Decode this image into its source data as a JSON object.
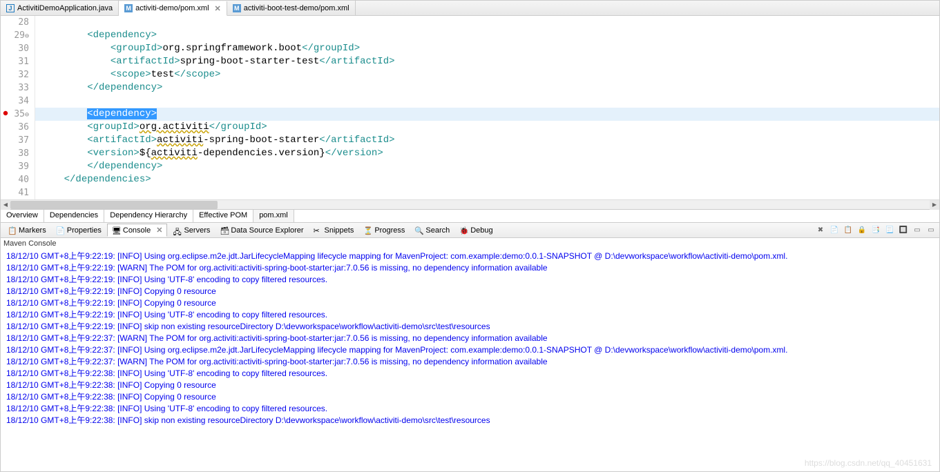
{
  "tabs": [
    {
      "label": "ActivitiDemoApplication.java",
      "icon": "J",
      "active": false
    },
    {
      "label": "activiti-demo/pom.xml",
      "icon": "M",
      "active": true
    },
    {
      "label": "activiti-boot-test-demo/pom.xml",
      "icon": "M",
      "active": false
    }
  ],
  "editor": {
    "lines": [
      {
        "n": "28",
        "html": ""
      },
      {
        "n": "29",
        "fold": "⊖",
        "html": "        <span class='tag'>&lt;dependency&gt;</span>"
      },
      {
        "n": "30",
        "html": "            <span class='tag'>&lt;groupId&gt;</span><span class='txt'>org.springframework.boot</span><span class='tag'>&lt;/groupId&gt;</span>"
      },
      {
        "n": "31",
        "html": "            <span class='tag'>&lt;artifactId&gt;</span><span class='txt'>spring-boot-starter-test</span><span class='tag'>&lt;/artifactId&gt;</span>"
      },
      {
        "n": "32",
        "html": "            <span class='tag'>&lt;scope&gt;</span><span class='txt'>test</span><span class='tag'>&lt;/scope&gt;</span>"
      },
      {
        "n": "33",
        "html": "        <span class='tag'>&lt;/dependency&gt;</span>"
      },
      {
        "n": "34",
        "html": ""
      },
      {
        "n": "35",
        "err": true,
        "fold": "⊖",
        "hl": true,
        "html": "        <span class='sel'>&lt;dependency&gt;</span>"
      },
      {
        "n": "36",
        "html": "        <span class='tag'>&lt;groupId&gt;</span><span class='txt underline'>org.activiti</span><span class='tag'>&lt;/groupId&gt;</span>"
      },
      {
        "n": "37",
        "html": "        <span class='tag'>&lt;artifactId&gt;</span><span class='txt underline'>activiti</span><span class='txt'>-spring-boot-starter</span><span class='tag'>&lt;/artifactId&gt;</span>"
      },
      {
        "n": "38",
        "html": "        <span class='tag'>&lt;version&gt;</span><span class='var'>${</span><span class='txt underline'>activiti</span><span class='txt'>-dependencies.version}</span><span class='tag'>&lt;/version&gt;</span>"
      },
      {
        "n": "39",
        "html": "        <span class='tag'>&lt;/dependency&gt;</span>"
      },
      {
        "n": "40",
        "html": "    <span class='tag'>&lt;/dependencies&gt;</span>"
      },
      {
        "n": "41",
        "html": ""
      }
    ]
  },
  "subtabs": [
    {
      "label": "Overview"
    },
    {
      "label": "Dependencies"
    },
    {
      "label": "Dependency Hierarchy"
    },
    {
      "label": "Effective POM"
    },
    {
      "label": "pom.xml",
      "active": true
    }
  ],
  "views": [
    {
      "label": "Markers",
      "icon": "📋"
    },
    {
      "label": "Properties",
      "icon": "📄"
    },
    {
      "label": "Console",
      "icon": "🖥",
      "active": true
    },
    {
      "label": "Servers",
      "icon": "🖧"
    },
    {
      "label": "Data Source Explorer",
      "icon": "🗃"
    },
    {
      "label": "Snippets",
      "icon": "✂"
    },
    {
      "label": "Progress",
      "icon": "⏳"
    },
    {
      "label": "Search",
      "icon": "🔍"
    },
    {
      "label": "Debug",
      "icon": "🐞"
    }
  ],
  "console_title": "Maven Console",
  "console": [
    "18/12/10 GMT+8上午9:22:19: [INFO] Using org.eclipse.m2e.jdt.JarLifecycleMapping lifecycle mapping for MavenProject: com.example:demo:0.0.1-SNAPSHOT @ D:\\devworkspace\\workflow\\activiti-demo\\pom.xml.",
    "18/12/10 GMT+8上午9:22:19: [WARN] The POM for org.activiti:activiti-spring-boot-starter:jar:7.0.56 is missing, no dependency information available",
    "18/12/10 GMT+8上午9:22:19: [INFO] Using 'UTF-8' encoding to copy filtered resources.",
    "18/12/10 GMT+8上午9:22:19: [INFO] Copying 0 resource",
    "18/12/10 GMT+8上午9:22:19: [INFO] Copying 0 resource",
    "18/12/10 GMT+8上午9:22:19: [INFO] Using 'UTF-8' encoding to copy filtered resources.",
    "18/12/10 GMT+8上午9:22:19: [INFO] skip non existing resourceDirectory D:\\devworkspace\\workflow\\activiti-demo\\src\\test\\resources",
    "18/12/10 GMT+8上午9:22:37: [WARN] The POM for org.activiti:activiti-spring-boot-starter:jar:7.0.56 is missing, no dependency information available",
    "18/12/10 GMT+8上午9:22:37: [INFO] Using org.eclipse.m2e.jdt.JarLifecycleMapping lifecycle mapping for MavenProject: com.example:demo:0.0.1-SNAPSHOT @ D:\\devworkspace\\workflow\\activiti-demo\\pom.xml.",
    "18/12/10 GMT+8上午9:22:37: [WARN] The POM for org.activiti:activiti-spring-boot-starter:jar:7.0.56 is missing, no dependency information available",
    "18/12/10 GMT+8上午9:22:38: [INFO] Using 'UTF-8' encoding to copy filtered resources.",
    "18/12/10 GMT+8上午9:22:38: [INFO] Copying 0 resource",
    "18/12/10 GMT+8上午9:22:38: [INFO] Copying 0 resource",
    "18/12/10 GMT+8上午9:22:38: [INFO] Using 'UTF-8' encoding to copy filtered resources.",
    "18/12/10 GMT+8上午9:22:38: [INFO] skip non existing resourceDirectory D:\\devworkspace\\workflow\\activiti-demo\\src\\test\\resources"
  ],
  "close_glyph": "✕",
  "watermark": "https://blog.csdn.net/qq_40451631"
}
